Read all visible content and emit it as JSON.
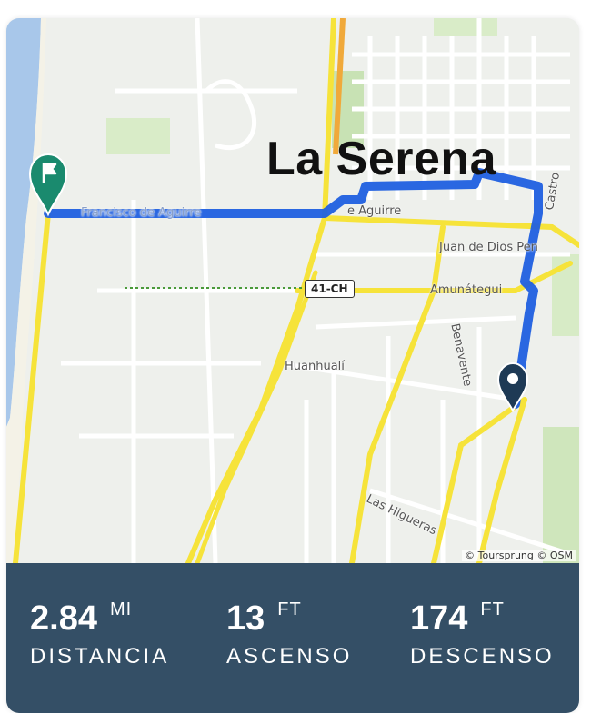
{
  "map": {
    "city_label": "La Serena",
    "streets": {
      "aguirre": "e Aguirre",
      "juan_de_dios": "Juan de Dios Pen",
      "amunategui": "Amunátegui",
      "castro": "Castro",
      "benavente": "Benavente",
      "huanhuali": "Huanhualí",
      "las_higueras": "Las Higueras",
      "francisco": "Francisco de Aguirre"
    },
    "route_shield": "41-CH",
    "attribution": "© Toursprung © OSM",
    "route_color": "#1f5fe0",
    "start_marker_color": "#1e3a55",
    "end_marker_color": "#1a8a6e"
  },
  "stats": [
    {
      "value": "2.84",
      "unit": "MI",
      "label": "DISTANCIA"
    },
    {
      "value": "13",
      "unit": "FT",
      "label": "ASCENSO"
    },
    {
      "value": "174",
      "unit": "FT",
      "label": "DESCENSO"
    }
  ]
}
